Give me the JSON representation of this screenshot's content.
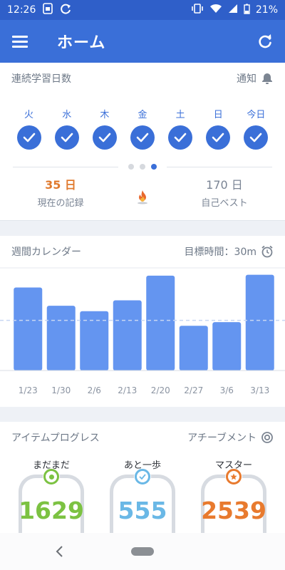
{
  "status_bar": {
    "time": "12:26",
    "battery": "21%"
  },
  "app_bar": {
    "title": "ホーム"
  },
  "streak": {
    "title": "連続学習日数",
    "notify_label": "通知",
    "days": [
      "火",
      "水",
      "木",
      "金",
      "土",
      "日",
      "今日"
    ],
    "current_value": "35 日",
    "current_label": "現在の記録",
    "best_value": "170 日",
    "best_label": "自己ベスト",
    "page": {
      "count": 3,
      "active": 3
    }
  },
  "calendar": {
    "title": "週間カレンダー",
    "goal_label": "目標時間：30m"
  },
  "chart_data": {
    "type": "bar",
    "categories": [
      "1/23",
      "1/30",
      "2/6",
      "2/13",
      "2/20",
      "2/27",
      "3/6",
      "3/13"
    ],
    "values": [
      0.91,
      0.71,
      0.65,
      0.77,
      1.04,
      0.49,
      0.53,
      1.05
    ],
    "goal_fraction": 0.55,
    "bar_color": "#6495f0",
    "grid": false
  },
  "progress": {
    "title": "アイテムプログレス",
    "achievement_label": "アチーブメント",
    "items": [
      {
        "label": "まだまだ",
        "value": "1629",
        "color": "#7cc242"
      },
      {
        "label": "あと一歩",
        "value": "555",
        "color": "#6ab8e6"
      },
      {
        "label": "マスター",
        "value": "2539",
        "color": "#e87a2e"
      }
    ]
  },
  "colors": {
    "primary": "#3a6fd8",
    "status": "#2f5fc9",
    "accent_orange": "#e07a2e"
  }
}
